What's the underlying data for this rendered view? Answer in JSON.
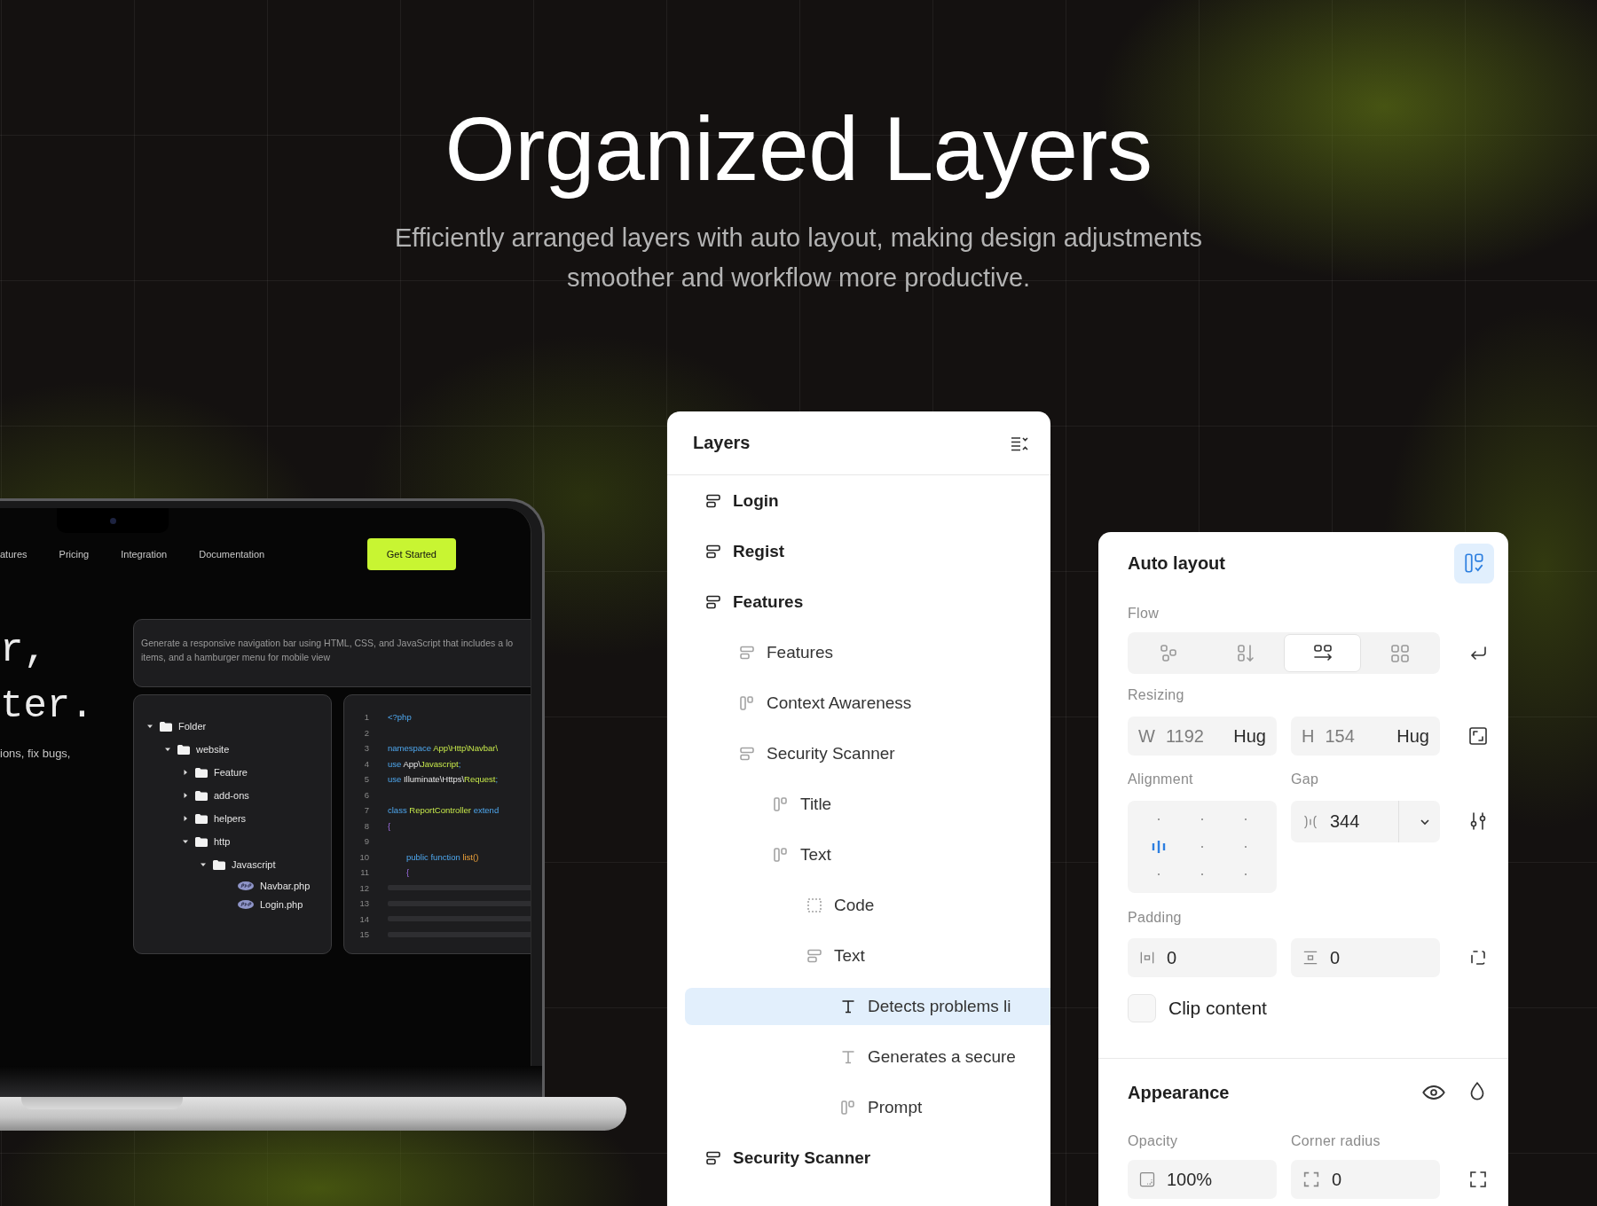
{
  "header": {
    "title": "Organized Layers",
    "subtitle": "Efficiently arranged layers with auto layout, making design adjustments smoother and workflow more productive."
  },
  "laptop": {
    "nav": [
      "atures",
      "Pricing",
      "Integration",
      "Documentation"
    ],
    "cta": "Get Started",
    "hero_lines": [
      "r,",
      "ter."
    ],
    "hero_caption": "ions, fix bugs,",
    "prompt_lines": [
      "Generate a responsive navigation bar using HTML, CSS, and JavaScript that includes a lo",
      "items, and a hamburger menu for mobile view"
    ],
    "tree": [
      {
        "label": "Folder",
        "kind": "folder",
        "expanded": true,
        "children": [
          {
            "label": "website",
            "kind": "folder",
            "expanded": true,
            "children": [
              {
                "label": "Feature",
                "kind": "folder",
                "expanded": false
              },
              {
                "label": "add-ons",
                "kind": "folder",
                "expanded": false
              },
              {
                "label": "helpers",
                "kind": "folder",
                "expanded": false
              },
              {
                "label": "http",
                "kind": "folder",
                "expanded": true,
                "children": [
                  {
                    "label": "Javascript",
                    "kind": "folder",
                    "expanded": true,
                    "children": [
                      {
                        "label": "Navbar.php",
                        "kind": "file"
                      },
                      {
                        "label": "Login.php",
                        "kind": "file"
                      }
                    ]
                  }
                ]
              }
            ]
          }
        ]
      }
    ],
    "code": {
      "line_numbers": [
        "1",
        "2",
        "3",
        "4",
        "5",
        "6",
        "7",
        "8",
        "9",
        "10",
        "11",
        "12",
        "13",
        "14",
        "15"
      ],
      "lines": [
        {
          "kind": "code",
          "indented": false,
          "tokens": [
            {
              "text": "<?php",
              "kind": "keyword"
            }
          ]
        },
        {
          "kind": "blank"
        },
        {
          "kind": "code",
          "indented": false,
          "tokens": [
            {
              "text": "namespace ",
              "kind": "keyword"
            },
            {
              "text": "App\\Http\\Navbar\\",
              "kind": "type"
            }
          ]
        },
        {
          "kind": "code",
          "indented": false,
          "tokens": [
            {
              "text": "use ",
              "kind": "keyword"
            },
            {
              "text": "App\\",
              "kind": "plain"
            },
            {
              "text": "Javascript",
              "kind": "type"
            },
            {
              "text": ";",
              "kind": "keyword"
            }
          ]
        },
        {
          "kind": "code",
          "indented": false,
          "tokens": [
            {
              "text": "use ",
              "kind": "keyword"
            },
            {
              "text": "Illuminate\\Https\\",
              "kind": "plain"
            },
            {
              "text": "Request",
              "kind": "type"
            },
            {
              "text": ";",
              "kind": "keyword"
            }
          ]
        },
        {
          "kind": "blank"
        },
        {
          "kind": "code",
          "indented": false,
          "tokens": [
            {
              "text": "class ",
              "kind": "keyword"
            },
            {
              "text": "ReportController ",
              "kind": "type"
            },
            {
              "text": "extend",
              "kind": "keyword"
            }
          ]
        },
        {
          "kind": "code",
          "indented": false,
          "tokens": [
            {
              "text": "{",
              "kind": "punct"
            }
          ]
        },
        {
          "kind": "blank"
        },
        {
          "kind": "code",
          "indented": true,
          "tokens": [
            {
              "text": "public function ",
              "kind": "keyword"
            },
            {
              "text": "list()",
              "kind": "call"
            }
          ]
        },
        {
          "kind": "code",
          "indented": true,
          "tokens": [
            {
              "text": "{",
              "kind": "punct"
            }
          ]
        },
        {
          "kind": "placeholder"
        },
        {
          "kind": "placeholder"
        },
        {
          "kind": "placeholder"
        },
        {
          "kind": "placeholder"
        }
      ]
    }
  },
  "layers_panel": {
    "title": "Layers",
    "items": [
      {
        "label": "Login",
        "kind": "stack",
        "selected": false
      },
      {
        "label": "Regist",
        "kind": "stack",
        "selected": false
      },
      {
        "label": "Features",
        "kind": "stack",
        "selected": false,
        "children": [
          {
            "label": "Features",
            "kind": "stack",
            "selected": false
          },
          {
            "label": "Context Awareness",
            "kind": "columns",
            "selected": false
          },
          {
            "label": "Security Scanner",
            "kind": "stack",
            "selected": false,
            "children": [
              {
                "label": "Title",
                "kind": "columns",
                "selected": false
              },
              {
                "label": "Text",
                "kind": "columns",
                "selected": false,
                "children": [
                  {
                    "label": "Code",
                    "kind": "frame",
                    "selected": false
                  },
                  {
                    "label": "Text",
                    "kind": "stack",
                    "selected": false,
                    "children": [
                      {
                        "label": "Detects problems li",
                        "kind": "text",
                        "selected": true
                      },
                      {
                        "label": "Generates a secure",
                        "kind": "text",
                        "selected": false
                      },
                      {
                        "label": "Prompt",
                        "kind": "columns",
                        "selected": false
                      }
                    ]
                  }
                ]
              }
            ]
          }
        ]
      },
      {
        "label": "Security Scanner",
        "kind": "stack",
        "selected": false
      }
    ]
  },
  "auto_layout": {
    "title": "Auto layout",
    "active": true,
    "flow": {
      "label": "Flow",
      "options": [
        {
          "kind": "free",
          "selected": false
        },
        {
          "kind": "vertical",
          "selected": false
        },
        {
          "kind": "horizontal",
          "selected": true
        },
        {
          "kind": "grid",
          "selected": false
        }
      ]
    },
    "resizing": {
      "label": "Resizing",
      "fields": [
        {
          "axis": "W",
          "value": "1192",
          "mode": "Hug"
        },
        {
          "axis": "H",
          "value": "154",
          "mode": "Hug"
        }
      ]
    },
    "alignment": {
      "label": "Alignment",
      "cells": [
        {
          "selected": false
        },
        {
          "selected": false
        },
        {
          "selected": false
        },
        {
          "selected": true
        },
        {
          "selected": false
        },
        {
          "selected": false
        },
        {
          "selected": false
        },
        {
          "selected": false
        },
        {
          "selected": false
        }
      ]
    },
    "gap": {
      "label": "Gap",
      "value": "344"
    },
    "padding": {
      "label": "Padding",
      "fields": [
        {
          "kind": "horizontal",
          "value": "0"
        },
        {
          "kind": "vertical",
          "value": "0"
        }
      ]
    },
    "clip_content": {
      "label": "Clip content",
      "checked": false
    }
  },
  "appearance": {
    "title": "Appearance",
    "opacity": {
      "label": "Opacity",
      "value": "100%"
    },
    "corner_radius": {
      "label": "Corner radius",
      "value": "0"
    }
  }
}
